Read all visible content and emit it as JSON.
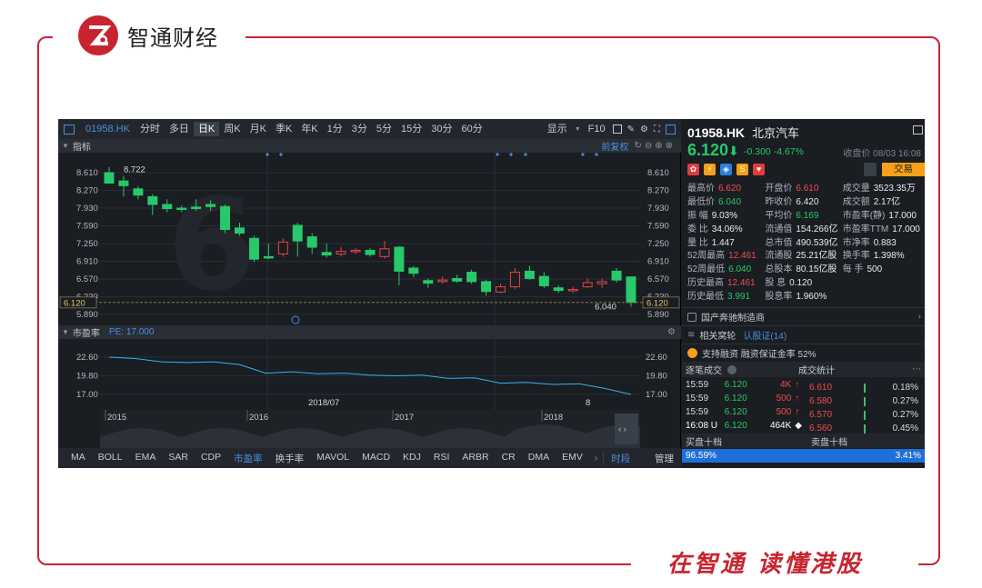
{
  "brand": {
    "logo_text": "智通财经",
    "slogan": "在智通  读懂港股",
    "accent": "#c8242f"
  },
  "toolbar": {
    "code": "01958.HK",
    "periods": [
      "分时",
      "多日",
      "日K",
      "周K",
      "月K",
      "季K",
      "年K",
      "1分",
      "3分",
      "5分",
      "15分",
      "30分",
      "60分"
    ],
    "active_period": "日K",
    "display_label": "显示",
    "f10_label": "F10"
  },
  "main_chart": {
    "panel_label": "指标",
    "adjust_label": "前复权",
    "y_ticks": [
      "8.610",
      "8.270",
      "7.930",
      "7.590",
      "7.250",
      "6.910",
      "6.570",
      "6.230",
      "5.890"
    ],
    "high_label": "8.722",
    "low_label": "6.040",
    "current_price_tag": "6.120",
    "date_label": "2018/07"
  },
  "pe_chart": {
    "panel_label": "市盈率",
    "pe_label": "PE: 17.000",
    "y_ticks": [
      "22.60",
      "19.80",
      "17.00"
    ],
    "marker_label": "8"
  },
  "timeline": {
    "years": [
      "2015",
      "2016",
      "2017",
      "2018"
    ]
  },
  "indicator_tabs": {
    "items": [
      "MA",
      "BOLL",
      "EMA",
      "SAR",
      "CDP",
      "市盈率",
      "换手率",
      "MAVOL",
      "MACD",
      "KDJ",
      "RSI",
      "ARBR",
      "CR",
      "DMA",
      "EMV"
    ],
    "active": "市盈率",
    "time_label": "时段",
    "manage_label": "管理"
  },
  "quote": {
    "code": "01958.HK",
    "name": "北京汽车",
    "price": "6.120",
    "change": "-0.300",
    "change_pct": "-4.67%",
    "date": "收盘价 08/03 16:08",
    "trade_label": "交易",
    "rows": [
      [
        [
          "最高价",
          "6.620",
          "red"
        ],
        [
          "开盘价",
          "6.610",
          "red"
        ],
        [
          "成交量",
          "3523.35万",
          ""
        ]
      ],
      [
        [
          "最低价",
          "6.040",
          "green"
        ],
        [
          "昨收价",
          "6.420",
          ""
        ],
        [
          "成交额",
          "2.17亿",
          ""
        ]
      ],
      [
        [
          "振  幅",
          "9.03%",
          ""
        ],
        [
          "平均价",
          "6.169",
          "green"
        ],
        [
          "市盈率(静)",
          "17.000",
          ""
        ]
      ],
      [
        [
          "委  比",
          "34.06%",
          ""
        ],
        [
          "流通值",
          "154.266亿",
          ""
        ],
        [
          "市盈率TTM",
          "17.000",
          ""
        ]
      ],
      [
        [
          "量  比",
          "1.447",
          ""
        ],
        [
          "总市值",
          "490.539亿",
          ""
        ],
        [
          "市净率",
          "0.883",
          ""
        ]
      ],
      [
        [
          "52周最高",
          "12.461",
          "red"
        ],
        [
          "流通股",
          "25.21亿股",
          ""
        ],
        [
          "换手率",
          "1.398%",
          ""
        ]
      ],
      [
        [
          "52周最低",
          "6.040",
          "green"
        ],
        [
          "总股本",
          "80.15亿股",
          ""
        ],
        [
          "每  手",
          "500",
          ""
        ]
      ],
      [
        [
          "历史最高",
          "12.461",
          "red"
        ],
        [
          "股  息",
          "0.120",
          ""
        ],
        [
          "",
          "",
          ""
        ]
      ],
      [
        [
          "历史最低",
          "3.991",
          "green"
        ],
        [
          "股息率",
          "1.960%",
          ""
        ],
        [
          "",
          "",
          ""
        ]
      ]
    ]
  },
  "sections": {
    "industry": "国产奔驰制造商",
    "warrants_label": "相关窝轮",
    "warrants_link": "认股证(14)",
    "margin": "支持融资  融资保证金率 52%"
  },
  "trades": {
    "head_left": "逐笔成交",
    "head_right": "成交统计",
    "rows": [
      [
        "15:59",
        "6.120",
        "4K",
        "↑"
      ],
      [
        "15:59",
        "6.120",
        "500",
        "↑"
      ],
      [
        "15:59",
        "6.120",
        "500",
        "↑"
      ],
      [
        "16:08 U",
        "6.120",
        "464K",
        "◆"
      ]
    ],
    "stats": [
      [
        "6.610",
        "0.18%"
      ],
      [
        "6.580",
        "0.27%"
      ],
      [
        "6.570",
        "0.27%"
      ],
      [
        "6.560",
        "0.45%"
      ]
    ]
  },
  "book": {
    "buy_label": "买盘十档",
    "sell_label": "卖盘十档",
    "buy_pct": "96.59%",
    "sell_pct": "3.41%"
  },
  "chart_data": {
    "type": "candlestick",
    "ylim": [
      5.89,
      8.722
    ],
    "candles": [
      [
        8.61,
        8.41,
        8.72,
        8.4
      ],
      [
        8.45,
        8.36,
        8.55,
        8.15
      ],
      [
        8.3,
        8.18,
        8.35,
        8.1
      ],
      [
        8.15,
        8.0,
        8.2,
        7.8
      ],
      [
        8.0,
        7.92,
        8.1,
        7.85
      ],
      [
        7.93,
        7.92,
        7.98,
        7.85
      ],
      [
        7.95,
        7.92,
        8.1,
        7.88
      ],
      [
        8.0,
        7.96,
        8.08,
        7.88
      ],
      [
        7.96,
        7.52,
        8.0,
        7.45
      ],
      [
        7.55,
        7.45,
        7.65,
        7.4
      ],
      [
        7.35,
        6.95,
        7.4,
        6.9
      ],
      [
        7.0,
        6.98,
        7.25,
        6.95
      ],
      [
        7.05,
        7.28,
        7.35,
        7.0
      ],
      [
        7.6,
        7.3,
        7.65,
        7.0
      ],
      [
        7.38,
        7.18,
        7.45,
        7.05
      ],
      [
        7.08,
        7.03,
        7.25,
        6.98
      ],
      [
        7.05,
        7.1,
        7.18,
        7.0
      ],
      [
        7.11,
        7.12,
        7.16,
        7.05
      ],
      [
        7.12,
        7.04,
        7.16,
        7.0
      ],
      [
        7.0,
        7.15,
        7.3,
        6.96
      ],
      [
        7.18,
        6.72,
        7.2,
        6.45
      ],
      [
        6.78,
        6.68,
        6.82,
        6.6
      ],
      [
        6.54,
        6.49,
        6.58,
        6.4
      ],
      [
        6.52,
        6.55,
        6.62,
        6.48
      ],
      [
        6.58,
        6.53,
        6.65,
        6.5
      ],
      [
        6.7,
        6.52,
        6.75,
        6.48
      ],
      [
        6.52,
        6.33,
        6.55,
        6.25
      ],
      [
        6.32,
        6.42,
        6.48,
        6.3
      ],
      [
        6.42,
        6.7,
        6.78,
        6.38
      ],
      [
        6.72,
        6.58,
        6.82,
        6.55
      ],
      [
        6.62,
        6.44,
        6.7,
        6.4
      ],
      [
        6.4,
        6.35,
        6.45,
        6.3
      ],
      [
        6.35,
        6.37,
        6.42,
        6.3
      ],
      [
        6.42,
        6.5,
        6.58,
        6.4
      ],
      [
        6.48,
        6.52,
        6.58,
        6.4
      ],
      [
        6.72,
        6.55,
        6.78,
        6.5
      ],
      [
        6.61,
        6.12,
        6.62,
        6.04
      ]
    ],
    "pe_series": [
      22.6,
      22.4,
      21.9,
      21.8,
      21.9,
      21.5,
      20.2,
      20.4,
      20.1,
      20.2,
      19.9,
      19.8,
      19.9,
      19.4,
      19.5,
      18.7,
      18.8,
      18.5,
      18.6,
      17.9,
      17.0
    ]
  }
}
